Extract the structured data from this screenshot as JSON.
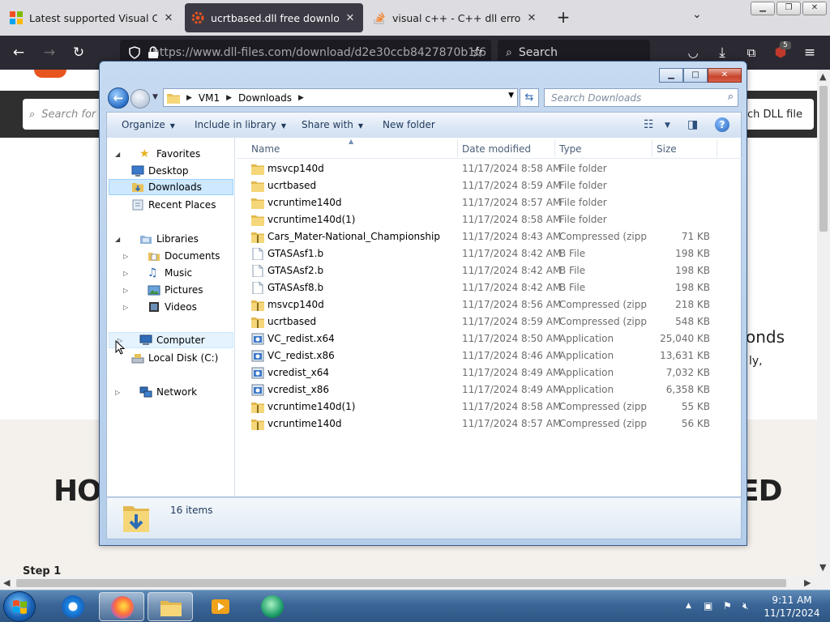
{
  "browser": {
    "tabs": [
      {
        "label": "Latest supported Visual C++ Re",
        "active": false
      },
      {
        "label": "ucrtbased.dll free download | D",
        "active": true
      },
      {
        "label": "visual c++ - C++ dll errors (_v",
        "active": false
      }
    ],
    "new_tab": "+",
    "url": "https://www.dll-files.com/download/d2e30ccb8427870b1f6",
    "search_placeholder": "Search",
    "extension_badge": "5"
  },
  "webpage": {
    "search_placeholder": "Search for",
    "search_button": "ch DLL file",
    "side_heading": "onds",
    "side_text": "ly,",
    "big_left": "HOV",
    "big_right": "ED",
    "step": "Step 1"
  },
  "explorer": {
    "breadcrumb": [
      "VM1",
      "Downloads"
    ],
    "search_placeholder": "Search Downloads",
    "commands": {
      "organize": "Organize",
      "include": "Include in library",
      "share": "Share with",
      "new_folder": "New folder"
    },
    "nav": {
      "favorites": "Favorites",
      "desktop": "Desktop",
      "downloads": "Downloads",
      "recent": "Recent Places",
      "libraries": "Libraries",
      "documents": "Documents",
      "music": "Music",
      "pictures": "Pictures",
      "videos": "Videos",
      "computer": "Computer",
      "local_disk": "Local Disk (C:)",
      "network": "Network"
    },
    "columns": {
      "name": "Name",
      "date": "Date modified",
      "type": "Type",
      "size": "Size"
    },
    "files": [
      {
        "name": "msvcp140d",
        "date": "11/17/2024 8:58 AM",
        "type": "File folder",
        "size": "",
        "icon": "folder"
      },
      {
        "name": "ucrtbased",
        "date": "11/17/2024 8:59 AM",
        "type": "File folder",
        "size": "",
        "icon": "folder"
      },
      {
        "name": "vcruntime140d",
        "date": "11/17/2024 8:57 AM",
        "type": "File folder",
        "size": "",
        "icon": "folder"
      },
      {
        "name": "vcruntime140d(1)",
        "date": "11/17/2024 8:58 AM",
        "type": "File folder",
        "size": "",
        "icon": "folder"
      },
      {
        "name": "Cars_Mater-National_Championship",
        "date": "11/17/2024 8:43 AM",
        "type": "Compressed (zipp...",
        "size": "71 KB",
        "icon": "zip"
      },
      {
        "name": "GTASAsf1.b",
        "date": "11/17/2024 8:42 AM",
        "type": "B File",
        "size": "198 KB",
        "icon": "file"
      },
      {
        "name": "GTASAsf2.b",
        "date": "11/17/2024 8:42 AM",
        "type": "B File",
        "size": "198 KB",
        "icon": "file"
      },
      {
        "name": "GTASAsf8.b",
        "date": "11/17/2024 8:42 AM",
        "type": "B File",
        "size": "198 KB",
        "icon": "file"
      },
      {
        "name": "msvcp140d",
        "date": "11/17/2024 8:56 AM",
        "type": "Compressed (zipp...",
        "size": "218 KB",
        "icon": "zip"
      },
      {
        "name": "ucrtbased",
        "date": "11/17/2024 8:59 AM",
        "type": "Compressed (zipp...",
        "size": "548 KB",
        "icon": "zip"
      },
      {
        "name": "VC_redist.x64",
        "date": "11/17/2024 8:50 AM",
        "type": "Application",
        "size": "25,040 KB",
        "icon": "app"
      },
      {
        "name": "VC_redist.x86",
        "date": "11/17/2024 8:46 AM",
        "type": "Application",
        "size": "13,631 KB",
        "icon": "app"
      },
      {
        "name": "vcredist_x64",
        "date": "11/17/2024 8:49 AM",
        "type": "Application",
        "size": "7,032 KB",
        "icon": "app"
      },
      {
        "name": "vcredist_x86",
        "date": "11/17/2024 8:49 AM",
        "type": "Application",
        "size": "6,358 KB",
        "icon": "app"
      },
      {
        "name": "vcruntime140d(1)",
        "date": "11/17/2024 8:58 AM",
        "type": "Compressed (zipp...",
        "size": "55 KB",
        "icon": "zip"
      },
      {
        "name": "vcruntime140d",
        "date": "11/17/2024 8:57 AM",
        "type": "Compressed (zipp...",
        "size": "56 KB",
        "icon": "zip"
      }
    ],
    "item_count": "16 items"
  },
  "taskbar": {
    "time": "9:11 AM",
    "date": "11/17/2024"
  },
  "colors": {
    "browser_dark": "#2b2a33",
    "explorer_frame": "#b9d1ec",
    "selection": "#cde8ff",
    "folder": "#e8c15a",
    "taskbar": "#3a6596"
  }
}
